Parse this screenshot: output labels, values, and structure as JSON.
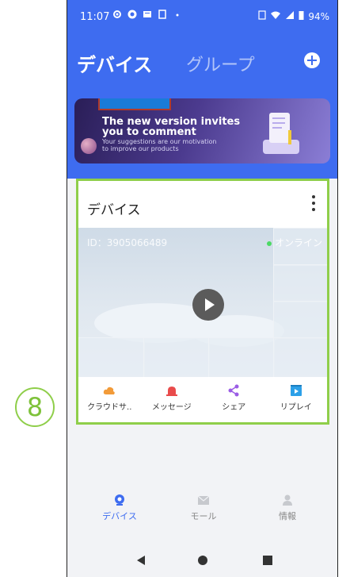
{
  "status": {
    "time": "11:07",
    "battery": "94%"
  },
  "header": {
    "active_tab": "デバイス",
    "inactive_tab": "グループ"
  },
  "banner": {
    "line1": "The new version invites",
    "line2": "you to comment",
    "sub1": "Your suggestions are our motivation",
    "sub2": "to improve our products"
  },
  "card": {
    "title": "デバイス",
    "device_id": "ID：3905066489",
    "status": "オンライン",
    "actions": [
      {
        "label": "クラウドサ..",
        "icon": "cloud-icon",
        "color": "#f29b39"
      },
      {
        "label": "メッセージ",
        "icon": "siren-icon",
        "color": "#e94b4b"
      },
      {
        "label": "シェア",
        "icon": "share-icon",
        "color": "#9b5de5"
      },
      {
        "label": "リプレイ",
        "icon": "replay-icon",
        "color": "#2ca0e8"
      }
    ]
  },
  "annotation": {
    "number": "8"
  },
  "tabbar": {
    "items": [
      {
        "label": "デバイス",
        "active": true,
        "icon": "camera-icon"
      },
      {
        "label": "モール",
        "active": false,
        "icon": "mail-icon"
      },
      {
        "label": "情報",
        "active": false,
        "icon": "person-icon"
      }
    ]
  },
  "colors": {
    "accent": "#3e6cf0",
    "highlight": "#8fce4a"
  }
}
